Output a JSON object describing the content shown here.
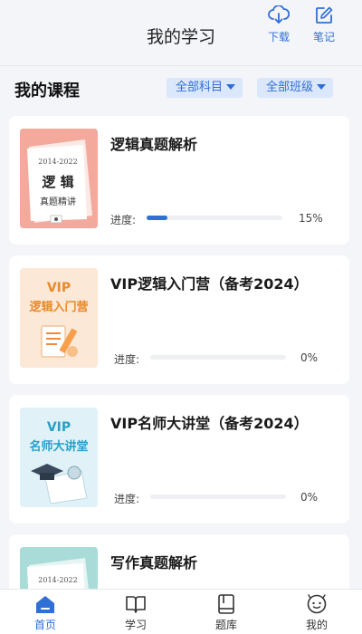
{
  "header": {
    "title": "我的学习",
    "download_label": "下载",
    "notes_label": "笔记"
  },
  "courses_section": {
    "title": "我的课程",
    "subject_filter": "全部科目",
    "class_filter": "全部班级"
  },
  "courses": [
    {
      "title": "逻辑真题解析",
      "progress_label": "进度:",
      "progress": 0.15,
      "progress_text": "15%",
      "thumb": {
        "years": "2014-2022",
        "main": "逻 辑",
        "sub": "真题精讲"
      }
    },
    {
      "title": "VIP逻辑入门营（备考2024）",
      "progress_label": "进度:",
      "progress": 0,
      "progress_text": "0%",
      "thumb": {
        "line1": "VIP",
        "line2": "逻辑入门营"
      }
    },
    {
      "title": "VIP名师大讲堂（备考2024）",
      "progress_label": "进度:",
      "progress": 0,
      "progress_text": "0%",
      "thumb": {
        "line1": "VIP",
        "line2": "名师大讲堂"
      }
    },
    {
      "title": "写作真题解析",
      "thumb": {
        "years": "2014-2022"
      }
    }
  ],
  "tabbar": {
    "home": "首页",
    "study": "学习",
    "question_bank": "题库",
    "mine": "我的"
  },
  "colors": {
    "accent": "#2f6fd6",
    "filter_bg": "#dbe7fb",
    "page_bg": "#f4f5f9"
  }
}
